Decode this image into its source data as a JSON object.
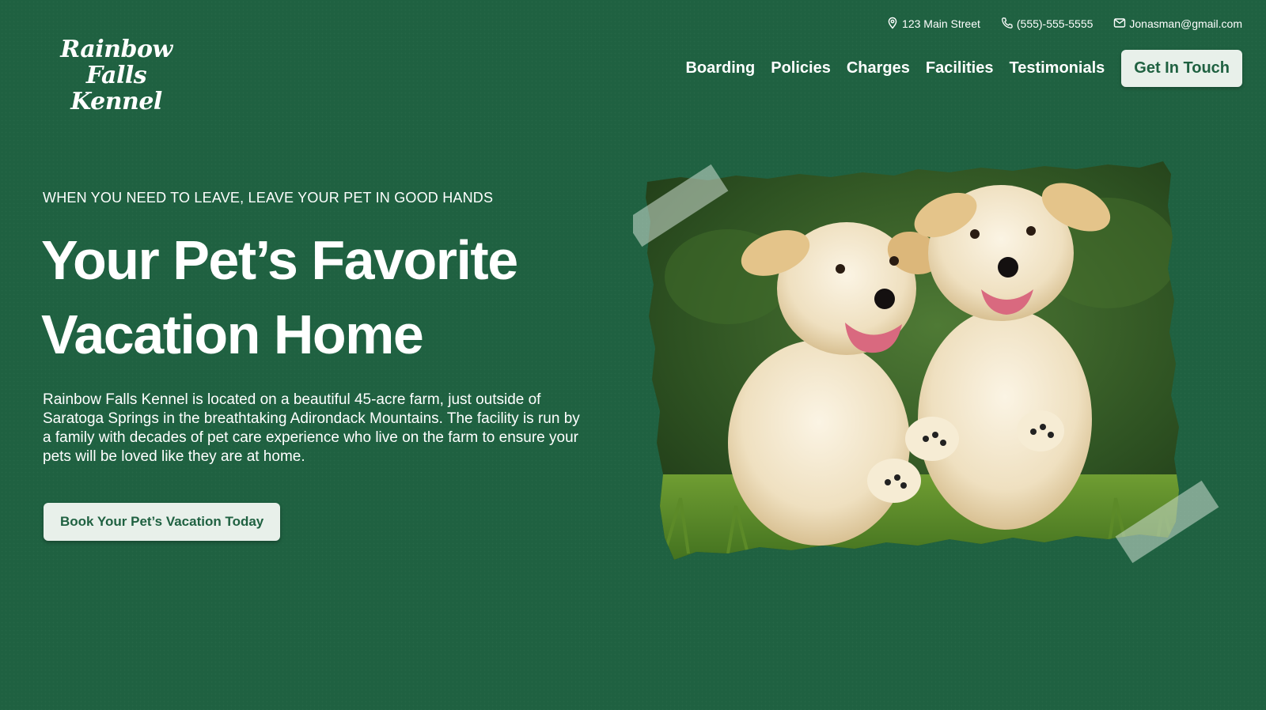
{
  "brand": {
    "line1": "Rainbow Falls",
    "line2": "Kennel"
  },
  "contact": {
    "address": "123 Main Street",
    "phone": "(555)-555-5555",
    "email": "Jonasman@gmail.com",
    "icons": [
      "map-pin-icon",
      "phone-icon",
      "mail-icon"
    ]
  },
  "nav": {
    "items": [
      "Boarding",
      "Policies",
      "Charges",
      "Facilities",
      "Testimonials"
    ],
    "cta_label": "Get In Touch"
  },
  "hero": {
    "eyebrow": "WHEN YOU NEED TO LEAVE, LEAVE YOUR PET IN GOOD HANDS",
    "headline_line1": "Your Pet’s Favorite",
    "headline_line2": "Vacation Home",
    "body": "Rainbow Falls Kennel is located on a beautiful 45-acre farm, just outside of Saratoga Springs in the breathtaking Adirondack Mountains. The facility is run by a family with decades of pet care experience who live on the farm to ensure your pets will be loved like they are at home.",
    "cta_label": "Book Your Pet’s Vacation Today"
  },
  "colors": {
    "background": "#1f6141",
    "button_bg": "#e8f0ea",
    "button_text": "#1f6141",
    "text": "#ffffff"
  }
}
